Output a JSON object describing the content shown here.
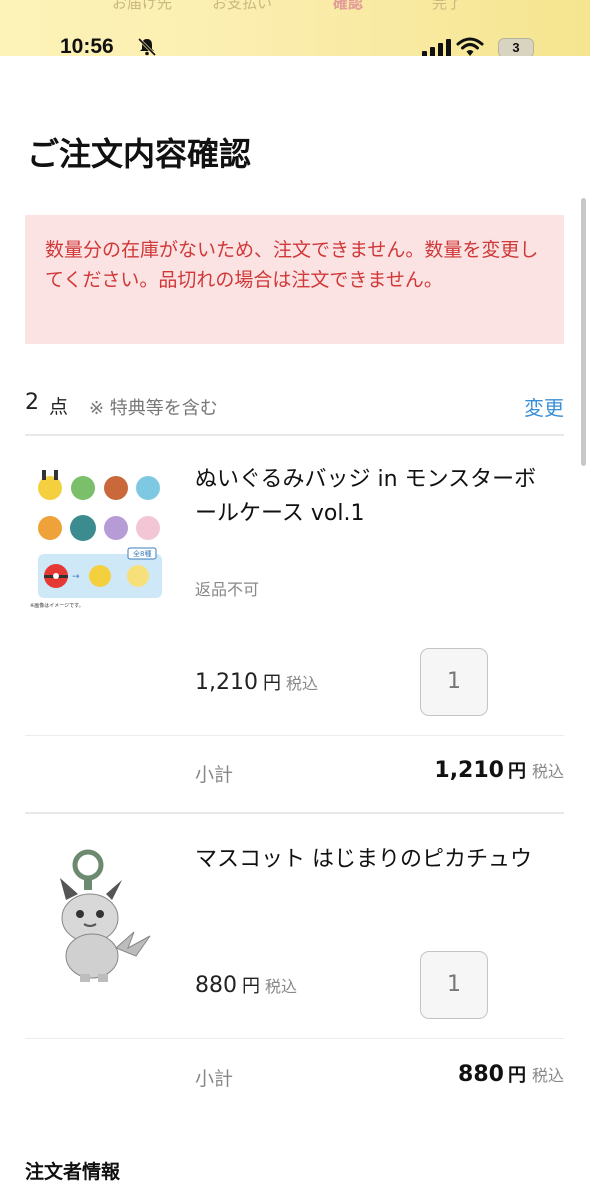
{
  "steps": [
    "お届け先",
    "お支払い",
    "確認",
    "完了"
  ],
  "status": {
    "time": "10:56",
    "battery": "3"
  },
  "page": {
    "title": "ご注文内容確認"
  },
  "alert": {
    "message": "数量分の在庫がないため、注文できません。数量を変更してください。品切れの場合は注文できません。"
  },
  "summary": {
    "count": "2",
    "unit": "点",
    "note": "※ 特典等を含む",
    "change": "変更"
  },
  "items": [
    {
      "name": "ぬいぐるみバッジ in モンスターボールケース vol.1",
      "note": "返品不可",
      "price": "1,210",
      "currency": "円",
      "tax": "税込",
      "quantity": "1",
      "subtotal_label": "小計",
      "subtotal": "1,210",
      "image_caption": "全8種",
      "image_footnote": "※画像はイメージです。"
    },
    {
      "name": "マスコット はじまりのピカチュウ",
      "note": "",
      "price": "880",
      "currency": "円",
      "tax": "税込",
      "quantity": "1",
      "subtotal_label": "小計",
      "subtotal": "880"
    }
  ],
  "orderer": {
    "title": "注文者情報"
  },
  "colors": {
    "alert_bg": "#fbe3e4",
    "alert_text": "#d13838",
    "link": "#3a8fd6"
  }
}
